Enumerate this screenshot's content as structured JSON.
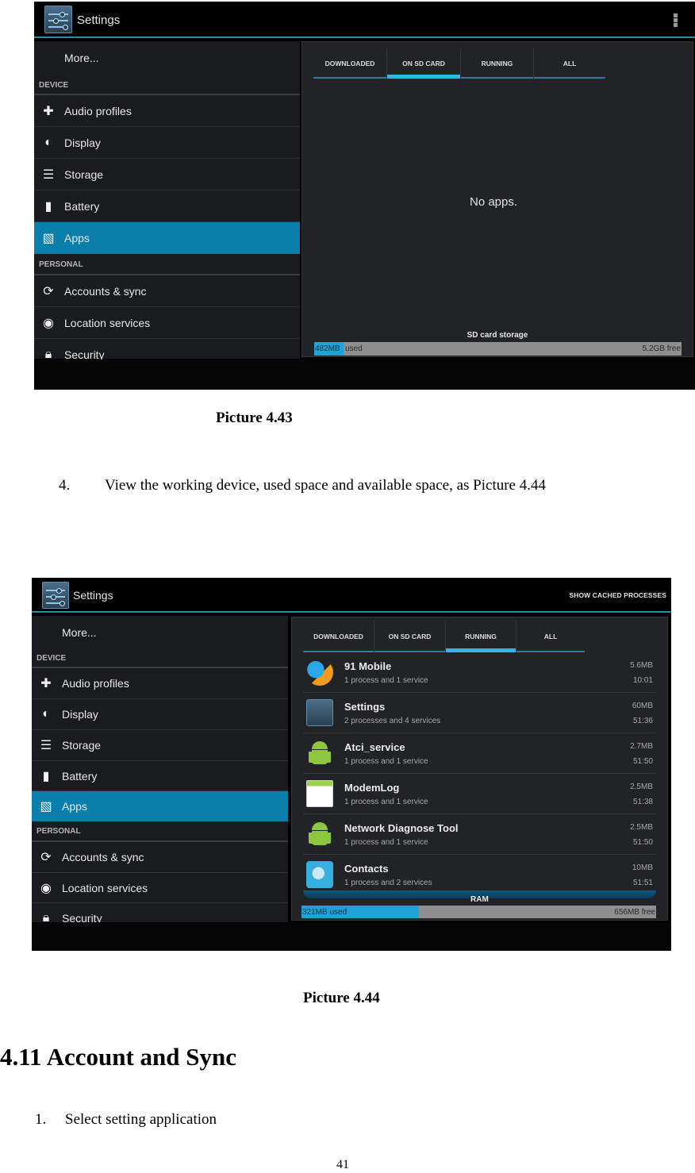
{
  "picture_443": {
    "actionbar": {
      "title": "Settings",
      "overflow_icon": "overflow-menu-icon"
    },
    "sidebar": {
      "more_label": "More...",
      "sections": [
        {
          "label": "DEVICE",
          "items": [
            {
              "label": "Audio profiles",
              "icon": "audio-profiles-icon"
            },
            {
              "label": "Display",
              "icon": "display-icon"
            },
            {
              "label": "Storage",
              "icon": "storage-icon"
            },
            {
              "label": "Battery",
              "icon": "battery-icon"
            },
            {
              "label": "Apps",
              "icon": "apps-icon",
              "selected": true
            }
          ]
        },
        {
          "label": "PERSONAL",
          "items": [
            {
              "label": "Accounts & sync",
              "icon": "sync-icon"
            },
            {
              "label": "Location services",
              "icon": "location-icon"
            },
            {
              "label": "Security",
              "icon": "lock-icon"
            }
          ]
        }
      ]
    },
    "tabs": [
      {
        "label": "DOWNLOADED"
      },
      {
        "label": "ON SD CARD",
        "active": true
      },
      {
        "label": "RUNNING"
      },
      {
        "label": "ALL"
      }
    ],
    "empty_message": "No apps.",
    "storage": {
      "label": "SD card storage",
      "used_value": "482MB",
      "used_suffix": "used",
      "free": "5.2GB free",
      "used_fraction": 0.08
    }
  },
  "caption_443": "Picture 4.43",
  "step_4": {
    "number": "4.",
    "text": "View the working device, used space and available space, as Picture 4.44"
  },
  "picture_444": {
    "actionbar": {
      "title": "Settings",
      "action": "SHOW CACHED PROCESSES"
    },
    "sidebar": {
      "more_label": "More...",
      "sections": [
        {
          "label": "DEVICE",
          "items": [
            {
              "label": "Audio profiles"
            },
            {
              "label": "Display"
            },
            {
              "label": "Storage"
            },
            {
              "label": "Battery"
            },
            {
              "label": "Apps",
              "selected": true
            }
          ]
        },
        {
          "label": "PERSONAL",
          "items": [
            {
              "label": "Accounts & sync"
            },
            {
              "label": "Location services"
            },
            {
              "label": "Security"
            }
          ]
        }
      ]
    },
    "tabs": [
      {
        "label": "DOWNLOADED"
      },
      {
        "label": "ON SD CARD"
      },
      {
        "label": "RUNNING",
        "active": true
      },
      {
        "label": "ALL"
      }
    ],
    "processes": [
      {
        "name": "91 Mobile",
        "detail": "1 process and 1 service",
        "memory": "5.6MB",
        "time": "10:01",
        "icon": "91-mobile-icon"
      },
      {
        "name": "Settings",
        "detail": "2 processes and 4 services",
        "memory": "60MB",
        "time": "51:36",
        "icon": "settings-app-icon"
      },
      {
        "name": "Atci_service",
        "detail": "1 process and 1 service",
        "memory": "2.7MB",
        "time": "51:50",
        "icon": "android-icon"
      },
      {
        "name": "ModemLog",
        "detail": "1 process and 1 service",
        "memory": "2.5MB",
        "time": "51:38",
        "icon": "modemlog-icon"
      },
      {
        "name": "Network Diagnose Tool",
        "detail": "1 process and 1 service",
        "memory": "2.5MB",
        "time": "51:50",
        "icon": "android-icon"
      },
      {
        "name": "Contacts",
        "detail": "1 process and 2 services",
        "memory": "10MB",
        "time": "51:51",
        "icon": "contacts-icon"
      }
    ],
    "ram": {
      "label": "RAM",
      "used": "321MB used",
      "free": "656MB free",
      "used_fraction": 0.33
    }
  },
  "caption_444": "Picture 4.44",
  "section_heading": "4.11 Account and Sync",
  "step_1": {
    "number": "1.",
    "text": "Select setting application"
  },
  "page_number": "41"
}
